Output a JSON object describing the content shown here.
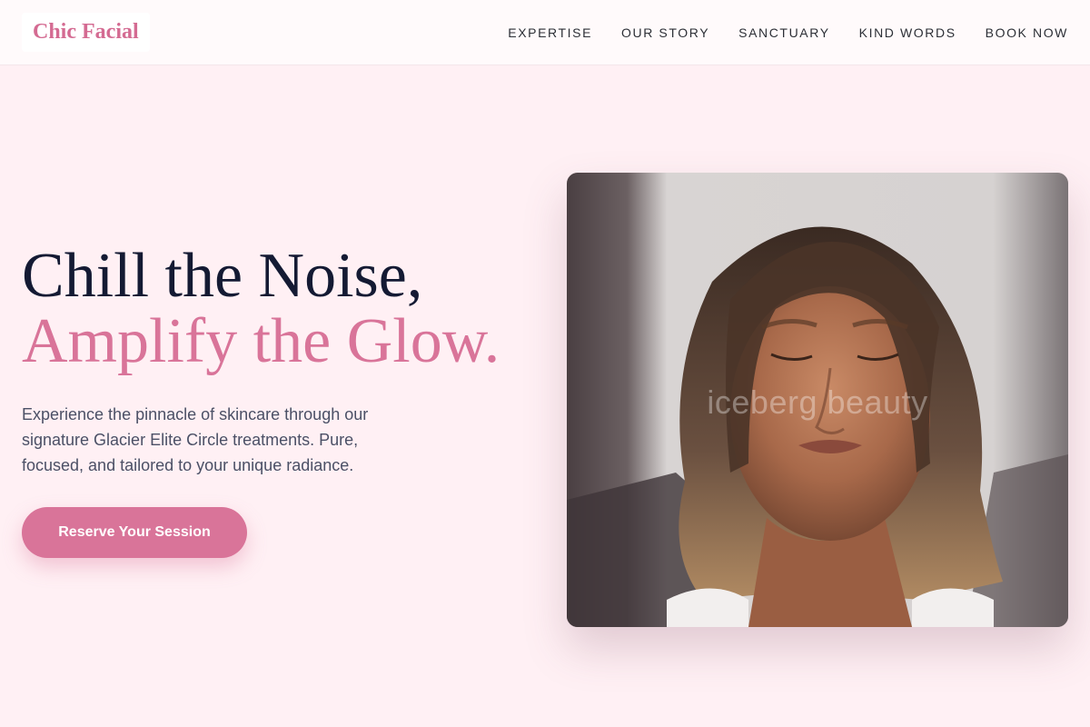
{
  "brand": {
    "name": "Chic Facial",
    "accent": "#d97499"
  },
  "nav": {
    "links": [
      "EXPERTISE",
      "OUR STORY",
      "SANCTUARY",
      "KIND WORDS",
      "BOOK NOW"
    ]
  },
  "hero": {
    "headline_line1": "Chill the Noise,",
    "headline_line2": "Amplify the Glow.",
    "description": "Experience the pinnacle of skincare through our signature Glacier Elite Circle treatments. Pure, focused, and tailored to your unique radiance.",
    "cta_label": "Reserve Your Session",
    "image_watermark": "iceberg beauty"
  },
  "colors": {
    "page_bg": "#fff0f4",
    "nav_bg": "#fffafb",
    "heading_dark": "#141a33",
    "heading_pink": "#d97499",
    "body_text": "#4b5066"
  }
}
